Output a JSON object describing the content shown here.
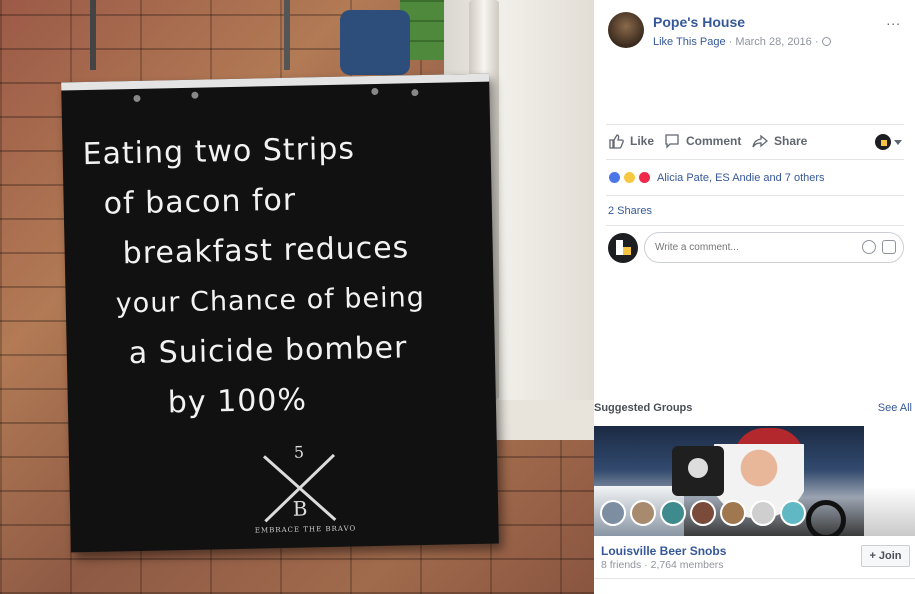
{
  "post": {
    "page_name": "Pope's House",
    "like_link": "Like This Page",
    "separator": " · ",
    "date": "March 28, 2016",
    "more": "..."
  },
  "image": {
    "chalk_lines": [
      "Eating two Strips",
      "of bacon for",
      "breakfast reduces",
      "your Chance of being",
      "a Suicide bomber",
      "by 100%"
    ],
    "logo_number": "5",
    "logo_letter": "B",
    "logo_caption": "EMBRACE THE BRAVO"
  },
  "actions": {
    "like": "Like",
    "comment": "Comment",
    "share": "Share"
  },
  "reactions": {
    "text": "Alicia Pate, ES Andie and 7 others",
    "icons": [
      "like-reaction-icon",
      "haha-reaction-icon",
      "love-reaction-icon"
    ]
  },
  "shares": "2 Shares",
  "comment": {
    "placeholder": "Write a comment..."
  },
  "suggested_groups": {
    "title": "Suggested Groups",
    "see_all": "See All",
    "group": {
      "name": "Louisville Beer Snobs",
      "meta": "8 friends · 2,764 members",
      "join": "Join",
      "join_icon": "+"
    }
  },
  "colors": {
    "link": "#365899",
    "muted": "#90949c",
    "like_blue": "#4a76e8",
    "haha_yellow": "#f7c843",
    "love_red": "#f0284a"
  }
}
